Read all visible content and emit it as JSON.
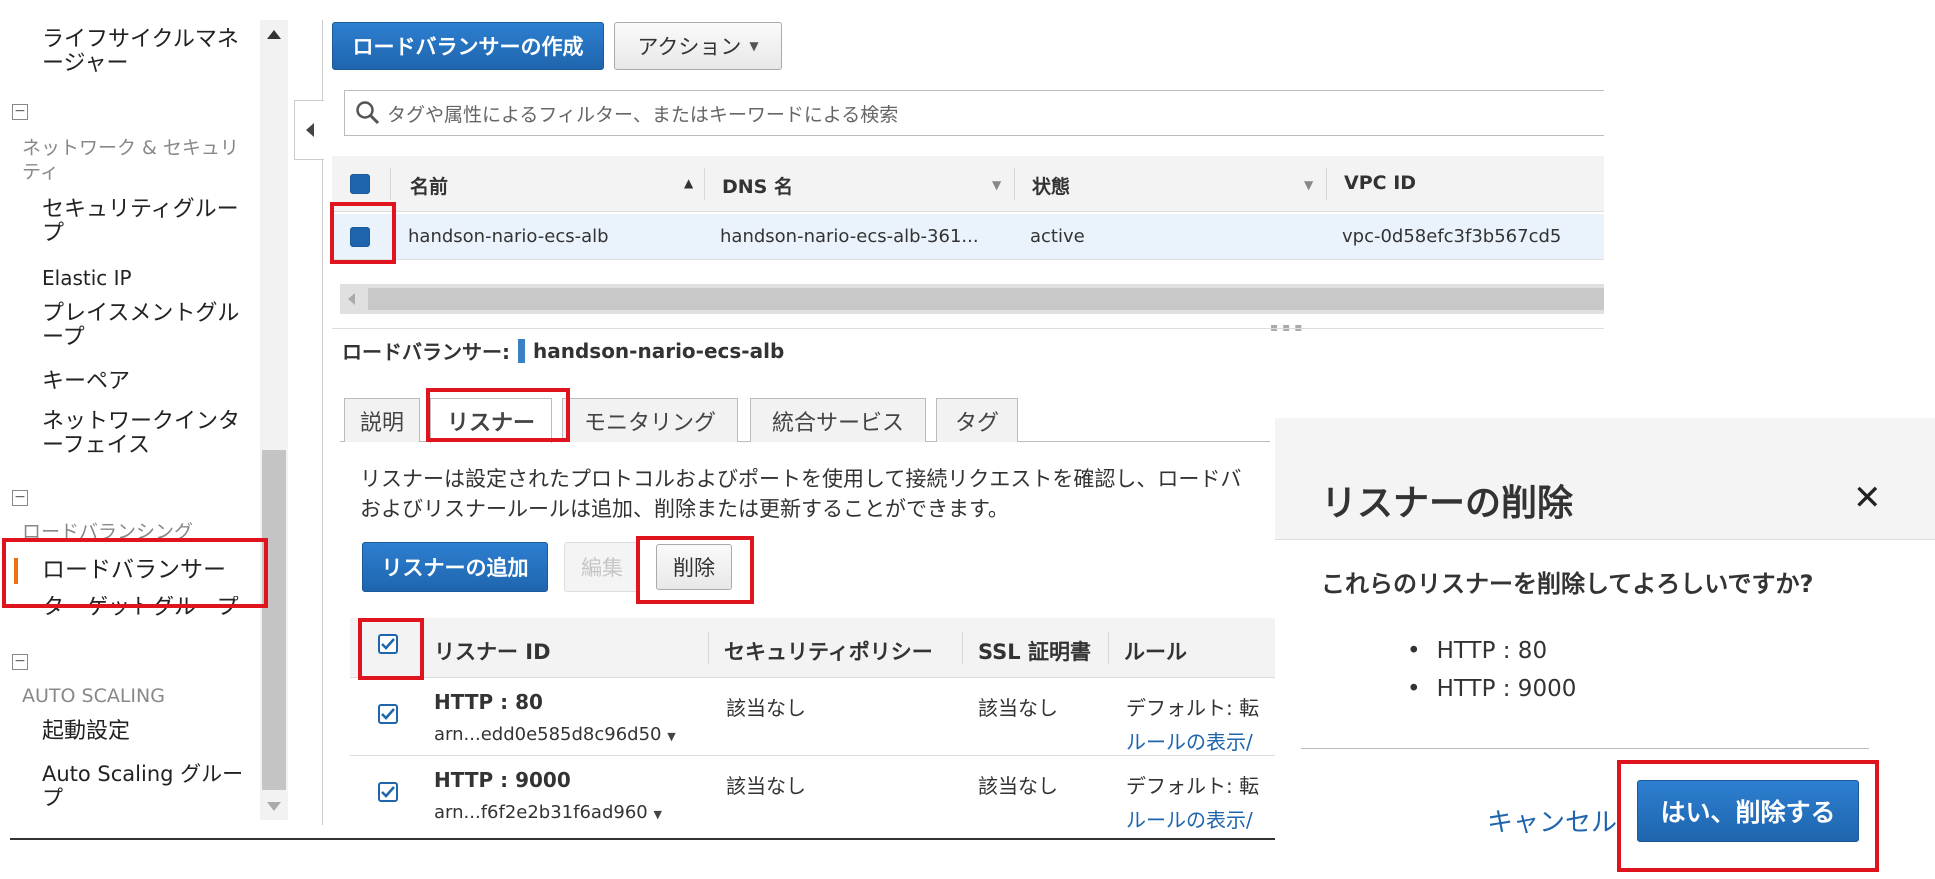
{
  "sidebar": {
    "items": {
      "lifecycle": "ライフサイクルマネージャー",
      "net_group": "ネットワーク & セキュリティ",
      "security_group": "セキュリティグループ",
      "elastic_ip": "Elastic IP",
      "placement": "プレイスメントグループ",
      "keypair": "キーペア",
      "eni": "ネットワークインターフェイス",
      "lb_group": "ロードバランシング",
      "load_balancer": "ロードバランサー",
      "target_group": "ターゲットグループ",
      "as_group": "AUTO SCALING",
      "launch_config": "起動設定",
      "as_group_item": "Auto Scaling グループ"
    },
    "toggle_glyph": "−"
  },
  "toolbar": {
    "create_lb": "ロードバランサーの作成",
    "actions": "アクション"
  },
  "search": {
    "placeholder": "タグや属性によるフィルター、またはキーワードによる検索"
  },
  "lb_table": {
    "headers": {
      "name": "名前",
      "dns": "DNS 名",
      "state": "状態",
      "vpc": "VPC ID"
    },
    "row": {
      "name": "handson-nario-ecs-alb",
      "dns": "handson-nario-ecs-alb-361...",
      "state": "active",
      "vpc": "vpc-0d58efc3f3b567cd5"
    }
  },
  "detail": {
    "label": "ロードバランサー:",
    "name": "handson-nario-ecs-alb",
    "tabs": [
      "説明",
      "リスナー",
      "モニタリング",
      "統合サービス",
      "タグ"
    ],
    "description_line1": "リスナーは設定されたプロトコルおよびポートを使用して接続リクエストを確認し、ロードバ",
    "description_line2": "およびリスナールールは追加、削除または更新することができます。",
    "add_listener": "リスナーの追加",
    "edit": "編集",
    "delete": "削除"
  },
  "listener_table": {
    "headers": {
      "id": "リスナー ID",
      "policy": "セキュリティポリシー",
      "ssl": "SSL 証明書",
      "rules": "ルール"
    },
    "rows": [
      {
        "id": "HTTP : 80",
        "arn": "arn...edd0e585d8c96d50",
        "policy": "該当なし",
        "ssl": "該当なし",
        "rule": "デフォルト: 転",
        "rule_link": "ルールの表示/"
      },
      {
        "id": "HTTP : 9000",
        "arn": "arn...f6f2e2b31f6ad960",
        "policy": "該当なし",
        "ssl": "該当なし",
        "rule": "デフォルト: 転",
        "rule_link": "ルールの表示/"
      }
    ]
  },
  "dialog": {
    "title": "リスナーの削除",
    "question": "これらのリスナーを削除してよろしいですか?",
    "items": [
      "HTTP : 80",
      "HTTP : 9000"
    ],
    "cancel": "キャンセル",
    "confirm": "はい、削除する",
    "close_glyph": "✕"
  },
  "colors": {
    "highlight": "#e0141e",
    "primary": "#1f65ad"
  }
}
